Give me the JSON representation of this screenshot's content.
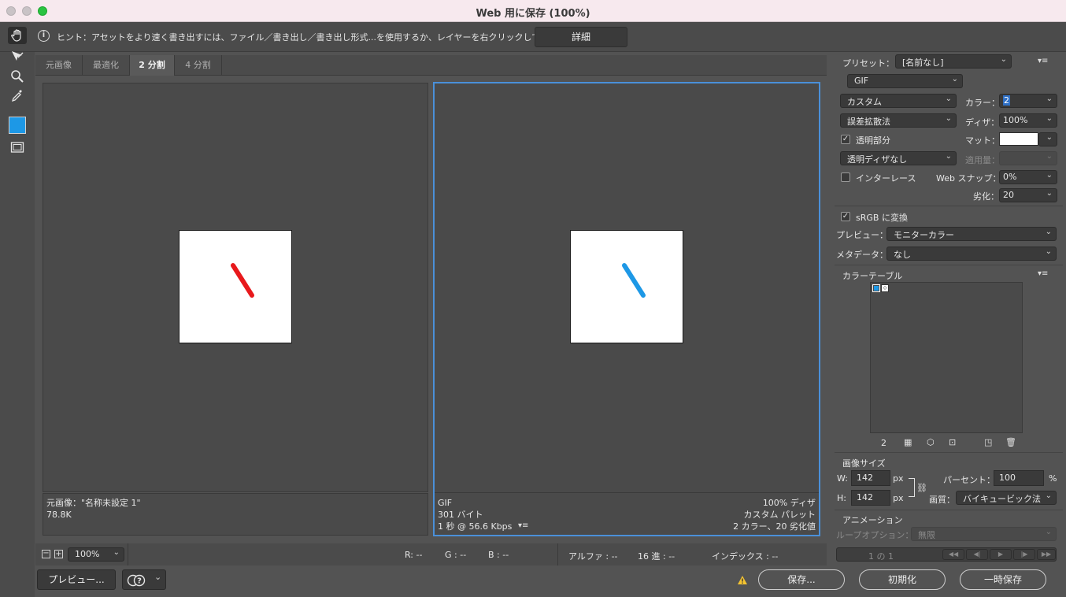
{
  "window": {
    "title": "Web 用に保存 (100%)"
  },
  "hint": {
    "text": "ヒント：アセットをより速く書き出すには、ファイル／書き出し／書き出し形式...を使用するか、レイヤーを右クリックして使用。",
    "details_label": "詳細"
  },
  "tabs": [
    {
      "label": "元画像",
      "active": false
    },
    {
      "label": "最適化",
      "active": false
    },
    {
      "label": "2 分割",
      "active": true
    },
    {
      "label": "4 分割",
      "active": false
    }
  ],
  "left_pane": {
    "line1": "元画像：\"名称未設定 1\"",
    "line2": "78.8K",
    "stroke_color": "#e8191c"
  },
  "right_pane": {
    "format": "GIF",
    "size": "301 バイト",
    "speed": "1 秒 @ 56.6 Kbps",
    "dither": "100% ディザ",
    "palette": "カスタム パレット",
    "colors": "2 カラー、20 劣化値",
    "stroke_color": "#1d98e6"
  },
  "settings": {
    "preset_label": "プリセット：",
    "preset_value": "[名前なし]",
    "format_value": "GIF",
    "reduction_value": "カスタム",
    "colors_label": "カラー：",
    "colors_value": "2",
    "dither_algo_value": "誤差拡散法",
    "dither_label": "ディザ：",
    "dither_value": "100%",
    "transparency_label": "透明部分",
    "matte_label": "マット：",
    "trans_dither_value": "透明ディザなし",
    "amount_label": "適用量：",
    "interlace_label": "インターレース",
    "websnap_label": "Web スナップ：",
    "websnap_value": "0%",
    "lossy_label": "劣化：",
    "lossy_value": "20",
    "srgb_label": "sRGB に変換",
    "preview_label": "プレビュー：",
    "preview_value": "モニターカラー",
    "metadata_label": "メタデータ：",
    "metadata_value": "なし"
  },
  "color_table": {
    "title": "カラーテーブル",
    "count": "2",
    "swatch_colors": [
      "#1d98e6",
      "#ffffff"
    ]
  },
  "image_size": {
    "title": "画像サイズ",
    "w_label": "W:",
    "w_value": "142",
    "h_label": "H:",
    "h_value": "142",
    "unit": "px",
    "percent_label": "パーセント：",
    "percent_value": "100",
    "percent_unit": "%",
    "quality_label": "画質：",
    "quality_value": "バイキュービック法"
  },
  "animation": {
    "title": "アニメーション",
    "loop_label": "ループオプション：",
    "loop_value": "無限",
    "frame_label": "1 の 1"
  },
  "statusbar": {
    "zoom_value": "100%",
    "r": "R: --",
    "g": "G : --",
    "b": "B : --",
    "alpha": "アルファ : --",
    "hex": "16 進 : --",
    "index": "インデックス : --"
  },
  "footer": {
    "preview_label": "プレビュー...",
    "save_label": "保存...",
    "reset_label": "初期化",
    "remember_label": "一時保存"
  },
  "colors": {
    "accent": "#1d98e6",
    "selection_border": "#4a90d9"
  }
}
